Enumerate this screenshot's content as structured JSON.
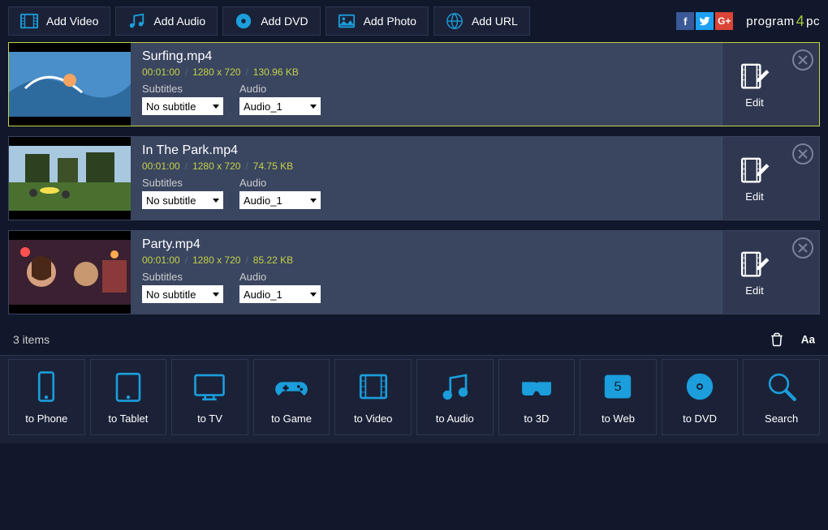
{
  "toolbar": {
    "addVideo": "Add Video",
    "addAudio": "Add Audio",
    "addDVD": "Add DVD",
    "addPhoto": "Add Photo",
    "addURL": "Add URL"
  },
  "brand": {
    "part1": "program",
    "accent": "4",
    "part2": "pc"
  },
  "labels": {
    "subtitles": "Subtitles",
    "audio": "Audio",
    "edit": "Edit"
  },
  "files": [
    {
      "name": "Surfing.mp4",
      "duration": "00:01:00",
      "resolution": "1280 x 720",
      "size": "130.96 KB",
      "subtitle": "No subtitle",
      "audio": "Audio_1",
      "selected": true,
      "thumb": "surf"
    },
    {
      "name": "In The Park.mp4",
      "duration": "00:01:00",
      "resolution": "1280 x 720",
      "size": "74.75 KB",
      "subtitle": "No subtitle",
      "audio": "Audio_1",
      "selected": false,
      "thumb": "park"
    },
    {
      "name": "Party.mp4",
      "duration": "00:01:00",
      "resolution": "1280 x 720",
      "size": "85.22 KB",
      "subtitle": "No subtitle",
      "audio": "Audio_1",
      "selected": false,
      "thumb": "party"
    }
  ],
  "status": {
    "count": "3  items"
  },
  "outputs": [
    {
      "label": "to Phone",
      "icon": "phone"
    },
    {
      "label": "to Tablet",
      "icon": "tablet"
    },
    {
      "label": "to TV",
      "icon": "tv"
    },
    {
      "label": "to Game",
      "icon": "game"
    },
    {
      "label": "to Video",
      "icon": "video"
    },
    {
      "label": "to Audio",
      "icon": "audio"
    },
    {
      "label": "to 3D",
      "icon": "3d"
    },
    {
      "label": "to Web",
      "icon": "web"
    },
    {
      "label": "to DVD",
      "icon": "dvd"
    },
    {
      "label": "Search",
      "icon": "search"
    }
  ]
}
